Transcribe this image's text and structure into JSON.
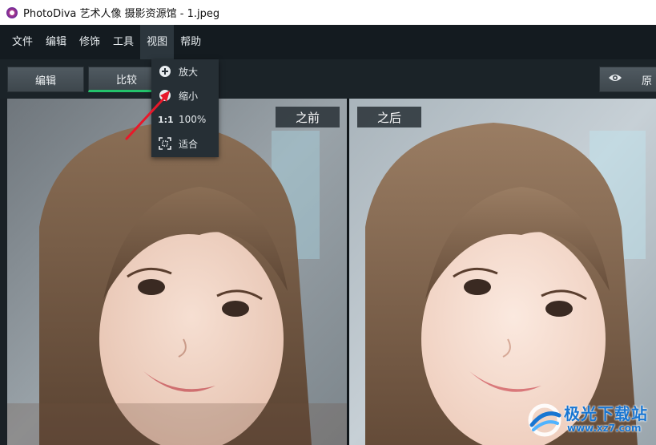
{
  "window": {
    "title": "PhotoDiva 艺术人像 摄影资源馆 - 1.jpeg"
  },
  "menubar": {
    "items": [
      {
        "label": "文件"
      },
      {
        "label": "编辑"
      },
      {
        "label": "修饰"
      },
      {
        "label": "工具"
      },
      {
        "label": "视图"
      },
      {
        "label": "帮助"
      }
    ],
    "active": "视图"
  },
  "toolbar": {
    "tab_edit": "编辑",
    "tab_compare": "比较",
    "original_label": "原"
  },
  "view_menu": {
    "items": [
      {
        "icon": "zoom-in-icon",
        "label": "放大"
      },
      {
        "icon": "zoom-out-icon",
        "label": "缩小"
      },
      {
        "icon_text": "1:1",
        "label": "100%"
      },
      {
        "icon": "fit-screen-icon",
        "label": "适合"
      }
    ]
  },
  "panels": {
    "before_label": "之前",
    "after_label": "之后"
  },
  "watermark": {
    "text": "极光下载站",
    "url": "www.xz7.com"
  },
  "colors": {
    "accent": "#23c26b",
    "menu_bg": "#141b20",
    "arrow": "#e8182a"
  }
}
